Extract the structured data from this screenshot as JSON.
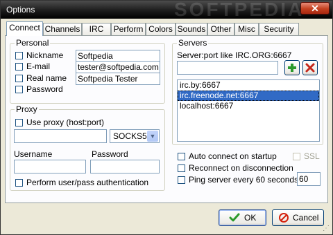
{
  "window": {
    "title": "Options",
    "watermark": "SOFTPEDIA"
  },
  "tabs": [
    "Connect",
    "Channels",
    "IRC",
    "Perform",
    "Colors",
    "Sounds",
    "Other",
    "Misc",
    "Security"
  ],
  "personal": {
    "legend": "Personal",
    "fields": [
      {
        "label": "Nickname",
        "value": "Softpedia",
        "checked": false
      },
      {
        "label": "E-mail",
        "value": "tester@softpedia.com",
        "checked": false
      },
      {
        "label": "Real name",
        "value": "Softpedia Tester",
        "checked": false
      },
      {
        "label": "Password",
        "value": "",
        "checked": false
      }
    ]
  },
  "proxy": {
    "legend": "Proxy",
    "use_label": "Use proxy (host:port)",
    "host_value": "",
    "type_value": "SOCKS5",
    "username_label": "Username",
    "password_label": "Password",
    "username_value": "",
    "password_value": "",
    "auth_label": "Perform user/pass authentication"
  },
  "servers": {
    "legend": "Servers",
    "hint": "Server:port like IRC.ORG:6667",
    "input_value": "",
    "items": [
      "irc.by:6667",
      "irc.freenode.net:6667",
      "localhost:6667"
    ],
    "selected": 1,
    "auto_connect_label": "Auto connect on startup",
    "ssl_label": "SSL",
    "reconnect_label": "Reconnect on disconnection",
    "ping_label": "Ping server every 60 seconds",
    "ping_value": "60"
  },
  "footer": {
    "ok_label": "OK",
    "cancel_label": "Cancel"
  },
  "colors": {
    "ok_check": "#2c9a2c",
    "cancel_circle": "#d4210c",
    "selection": "#316ac5",
    "add_button": "#2c9a2c",
    "remove_button": "#c4261a"
  },
  "icons": {
    "add": "plus-icon",
    "remove": "x-icon",
    "ok": "check-icon",
    "cancel": "no-entry-icon",
    "dropdown": "chevron-down-icon"
  }
}
